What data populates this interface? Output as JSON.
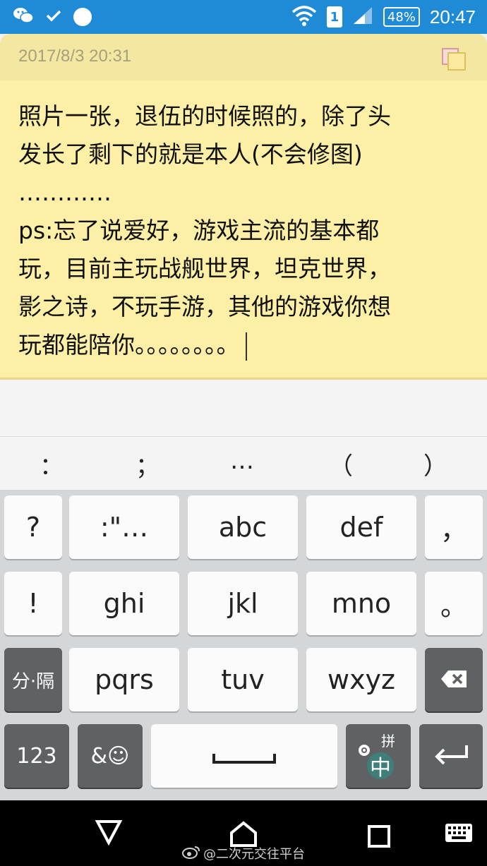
{
  "status_bar": {
    "battery": "48%",
    "sim_slot": "1",
    "time": "20:47"
  },
  "note": {
    "date": "2017/8/3 20:31",
    "text": "照片一张，退伍的时候照的，除了头\n发长了剩下的就是本人(不会修图)\n…………\nps:忘了说爱好，游戏主流的基本都\n玩，目前主玩战舰世界，坦克世界，\n影之诗，不玩手游，其他的游戏你想\n玩都能陪你。。。。。。。。"
  },
  "keyboard": {
    "suggestions": [
      "：",
      "；",
      "…",
      "（",
      "）"
    ],
    "row1": [
      "?",
      ":\"…",
      "abc",
      "def",
      "，"
    ],
    "row2": [
      "!",
      "ghi",
      "jkl",
      "mno",
      "。"
    ],
    "row3": [
      "分·隔",
      "pqrs",
      "tuv",
      "wxyz"
    ],
    "row4": {
      "num": "123",
      "emoji": "&☺",
      "pinyin": "拼",
      "zhong": "中"
    }
  },
  "watermark": "@二次元交往平台",
  "colors": {
    "status_bar": "#1f8ad6",
    "note_body": "#fdf0a6",
    "note_header": "#f4e7a2",
    "key_dark": "#5f6164"
  },
  "icons": [
    "wechat-icon",
    "check-icon",
    "circle-notification-icon",
    "wifi-icon",
    "signal-icon",
    "battery-icon",
    "note-color-icon",
    "backspace-icon",
    "enter-icon",
    "settings-icon",
    "back-nav-icon",
    "home-nav-icon",
    "recents-nav-icon",
    "keyboard-switch-icon",
    "weibo-icon"
  ]
}
